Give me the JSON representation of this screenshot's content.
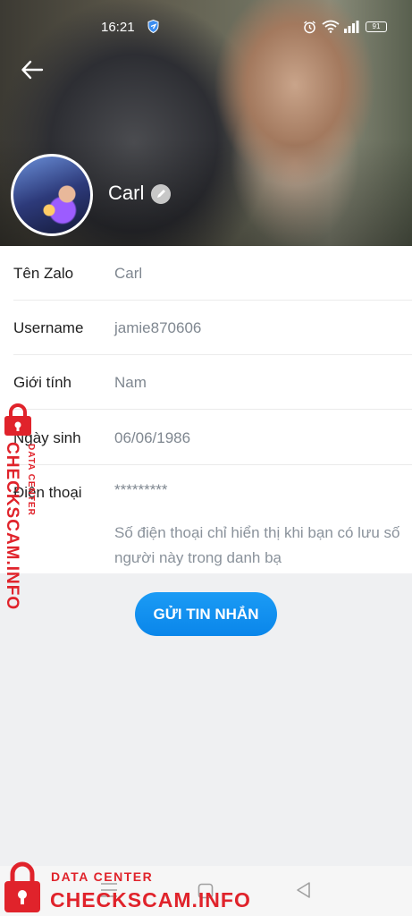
{
  "status_bar": {
    "time": "16:21",
    "battery": "91",
    "icons": [
      "shield-icon",
      "alarm-icon",
      "wifi-icon",
      "signal-icon",
      "battery-icon"
    ]
  },
  "header": {
    "name": "Carl",
    "back_icon": "arrow-left-icon",
    "edit_icon": "pencil-icon"
  },
  "info": {
    "rows": [
      {
        "label": "Tên Zalo",
        "value": "Carl"
      },
      {
        "label": "Username",
        "value": "jamie870606"
      },
      {
        "label": "Giới tính",
        "value": "Nam"
      },
      {
        "label": "Ngày sinh",
        "value": "06/06/1986"
      },
      {
        "label": "Điện thoại",
        "value": "*********"
      }
    ],
    "phone_note": "Số điện thoại chỉ hiển thị khi bạn có lưu số người này trong danh bạ"
  },
  "actions": {
    "send_message": "GỬI TIN NHẮN"
  },
  "watermark": {
    "top_line": "DATA CENTER",
    "brand": "CHECKSCAM.INFO"
  },
  "navbar": {
    "icons": [
      "menu-icon",
      "home-icon",
      "back-triangle-icon"
    ]
  },
  "colors": {
    "accent": "#0a86ea",
    "watermark": "#e0232b",
    "background": "#eff0f2"
  }
}
